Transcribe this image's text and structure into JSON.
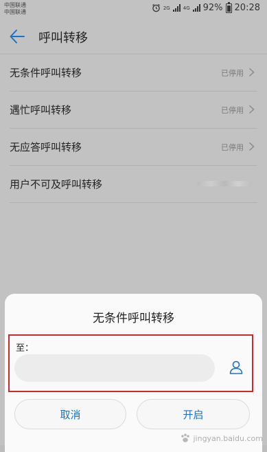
{
  "status_bar": {
    "carrier_1": "中国联通",
    "carrier_2": "中国联通",
    "net_1": "2G",
    "net_2": "4G",
    "battery": "92%",
    "time": "20:28",
    "battery_level": 0.92
  },
  "header": {
    "title": "呼叫转移"
  },
  "list": {
    "items": [
      {
        "label": "无条件呼叫转移",
        "status": "已停用"
      },
      {
        "label": "遇忙呼叫转移",
        "status": "已停用"
      },
      {
        "label": "无应答呼叫转移",
        "status": "已停用"
      },
      {
        "label": "用户不可及呼叫转移",
        "status": ""
      }
    ]
  },
  "dialog": {
    "title": "无条件呼叫转移",
    "to_label": "至：",
    "input_value": "",
    "input_placeholder": "",
    "cancel_label": "取消",
    "enable_label": "开启"
  },
  "colors": {
    "accent": "#1a73c8",
    "highlight": "#d0272f",
    "overlay": "#c2c2c2"
  },
  "icons": {
    "back": "arrow-left-icon",
    "chevron": "chevron-right-icon",
    "contact": "contact-person-icon",
    "alarm": "alarm-icon"
  }
}
